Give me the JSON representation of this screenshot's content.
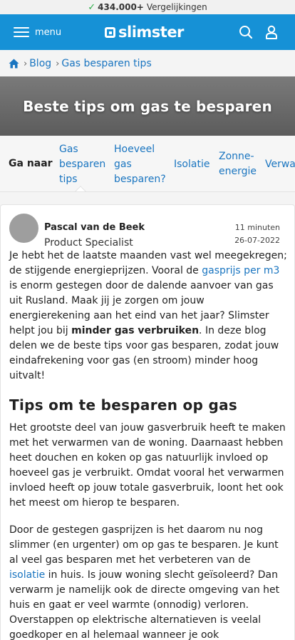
{
  "topbar": {
    "count": "434.000+",
    "label": "Vergelijkingen"
  },
  "header": {
    "menu_label": "menu",
    "logo_text": "slimster"
  },
  "breadcrumb": {
    "items": [
      "Blog",
      "Gas besparen tips"
    ]
  },
  "hero": {
    "title": "Beste tips om gas te besparen"
  },
  "toc": {
    "label": "Ga naar",
    "items": [
      {
        "lines": [
          "Gas",
          "besparen",
          "tips"
        ]
      },
      {
        "lines": [
          "Hoeveel",
          "gas",
          "besparen?"
        ]
      },
      {
        "lines": [
          "Isolatie"
        ]
      },
      {
        "lines": [
          "Zonne-",
          "energie"
        ]
      },
      {
        "lines": [
          "Verwarmen"
        ]
      }
    ]
  },
  "author": {
    "name": "Pascal van de Beek",
    "role": "Product Specialist",
    "time": "11 minuten",
    "date": "26-07-2022"
  },
  "article": {
    "p1_a": "Je hebt het de laatste maanden vast wel meegekregen; de stijgende energieprijzen. Vooral de ",
    "p1_link": "gasprijs per m3",
    "p1_b": " is enorm gestegen door de dalende aanvoer van gas uit Rusland. Maak jij je zorgen om jouw energierekening aan het eind van het jaar? Slimster helpt jou bij ",
    "p1_bold": "minder gas verbruiken",
    "p1_c": ". In deze blog delen we de beste tips voor gas besparen, zodat jouw eindafrekening voor gas (en stroom) minder hoog uitvalt!",
    "heading": "Tips om te besparen op gas",
    "p2": "Het grootste deel van jouw gasverbruik heeft te maken met het verwarmen van de woning. Daarnaast hebben heet douchen en koken op gas natuurlijk invloed op hoeveel gas je verbruikt. Omdat vooral het verwarmen invloed heeft op jouw totale gasverbruik, loont het ook het meest om hierop te besparen.",
    "p3_a": "Door de gestegen gasprijzen is het daarom nu nog slimmer (en urgenter) om op gas te besparen. Je kunt al veel gas besparen met het verbeteren van de ",
    "p3_link": "isolatie",
    "p3_b": " in huis. Is jouw woning slecht geïsoleerd? Dan verwarm je namelijk ook de directe omgeving van het huis en gaat er veel warmte (onnodig) verloren. Overstappen op elektrische alternatieven is veelal goedkoper en al helemaal wanneer je ook zonnepanelen hebt. Maar er zijn ook simpelere en"
  },
  "colors": {
    "brand": "#1691d6",
    "link": "#1a75c0",
    "check": "#2fae4a"
  }
}
